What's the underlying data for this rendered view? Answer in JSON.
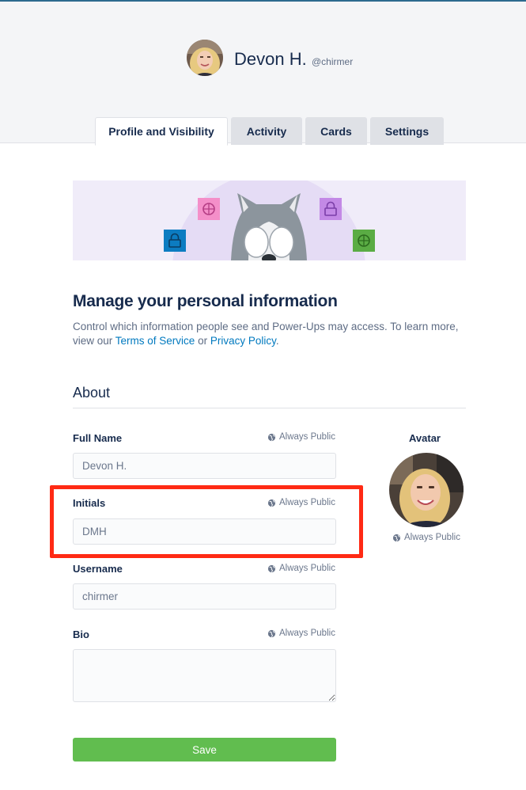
{
  "profile": {
    "name": "Devon H.",
    "handle": "@chirmer"
  },
  "tabs": [
    {
      "label": "Profile and Visibility",
      "active": true
    },
    {
      "label": "Activity",
      "active": false
    },
    {
      "label": "Cards",
      "active": false
    },
    {
      "label": "Settings",
      "active": false
    }
  ],
  "main": {
    "heading": "Manage your personal information",
    "description": {
      "text_before": "Control which information people see and Power-Ups may access. To learn more, view our ",
      "link_terms": "Terms of Service",
      "text_mid": " or ",
      "link_privacy": "Privacy Policy",
      "text_after": "."
    },
    "section_title": "About"
  },
  "fields": {
    "full_name": {
      "label": "Full Name",
      "visibility": "Always Public",
      "value": "Devon H."
    },
    "initials": {
      "label": "Initials",
      "visibility": "Always Public",
      "value": "DMH"
    },
    "username": {
      "label": "Username",
      "visibility": "Always Public",
      "value": "chirmer"
    },
    "bio": {
      "label": "Bio",
      "visibility": "Always Public",
      "value": ""
    }
  },
  "avatar": {
    "label": "Avatar",
    "visibility": "Always Public"
  },
  "save_label": "Save",
  "colors": {
    "accent_link": "#0079bf",
    "save_green": "#61bd4f",
    "highlight_red": "#ff2a14",
    "text_dark": "#172b4d"
  },
  "icons": [
    "globe-icon",
    "lock-icon",
    "dribbble-ball-icon",
    "husky-mascot"
  ]
}
